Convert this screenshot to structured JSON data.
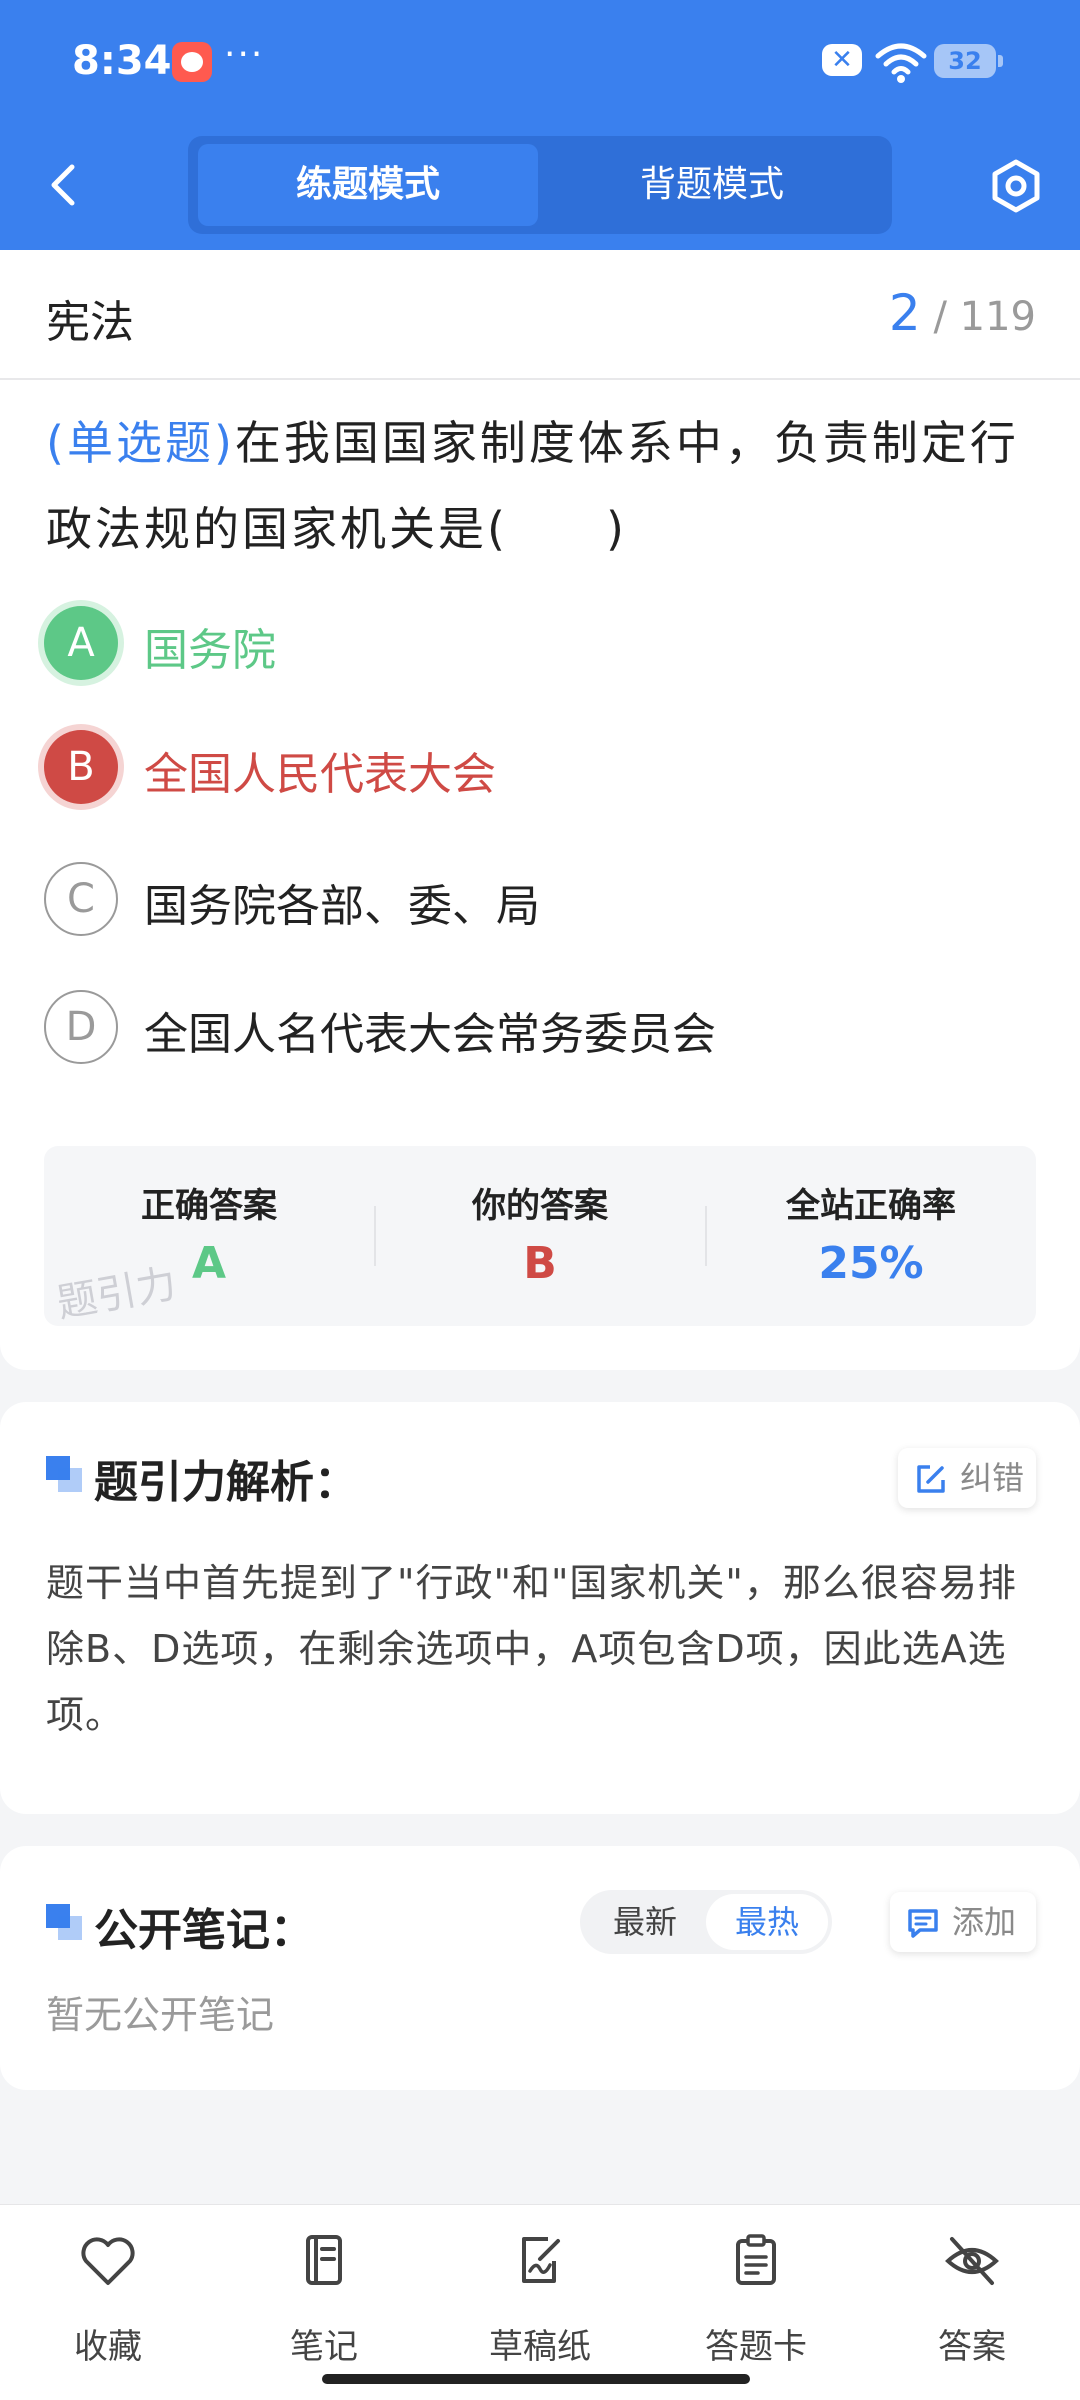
{
  "status_bar": {
    "time": "8:34",
    "dots": "···",
    "battery": "32"
  },
  "header": {
    "modes": [
      {
        "label": "练题模式",
        "active": true
      },
      {
        "label": "背题模式",
        "active": false
      }
    ]
  },
  "question": {
    "subject": "宪法",
    "current": "2",
    "total": "/ 119",
    "type_label": "(单选题)",
    "text": "在我国国家制度体系中，负责制定行政法规的国家机关是(　　)",
    "options": [
      {
        "letter": "A",
        "text": "国务院",
        "state": "correct"
      },
      {
        "letter": "B",
        "text": "全国人民代表大会",
        "state": "wrong"
      },
      {
        "letter": "C",
        "text": "国务院各部、委、局",
        "state": "normal"
      },
      {
        "letter": "D",
        "text": "全国人名代表大会常务委员会",
        "state": "normal"
      }
    ]
  },
  "stats": {
    "correct_label": "正确答案",
    "correct_value": "A",
    "yours_label": "你的答案",
    "yours_value": "B",
    "rate_label": "全站正确率",
    "rate_value": "25%",
    "watermark": "题引力"
  },
  "analysis": {
    "title": "题引力解析：",
    "report_label": "纠错",
    "text": "题干当中首先提到了\"行政\"和\"国家机关\"，那么很容易排除B、D选项，在剩余选项中，A项包含D项，因此选A选项。"
  },
  "notes": {
    "title": "公开笔记：",
    "sort_latest": "最新",
    "sort_hot": "最热",
    "add_label": "添加",
    "empty_text": "暂无公开笔记"
  },
  "bottom_nav": [
    {
      "label": "收藏",
      "icon": "heart-icon"
    },
    {
      "label": "笔记",
      "icon": "notebook-icon"
    },
    {
      "label": "草稿纸",
      "icon": "draft-paper-icon"
    },
    {
      "label": "答题卡",
      "icon": "answer-sheet-icon"
    },
    {
      "label": "答案",
      "icon": "eye-off-icon"
    }
  ],
  "colors": {
    "brand": "#3a80ee",
    "correct": "#5dc887",
    "wrong": "#cf4a45"
  }
}
